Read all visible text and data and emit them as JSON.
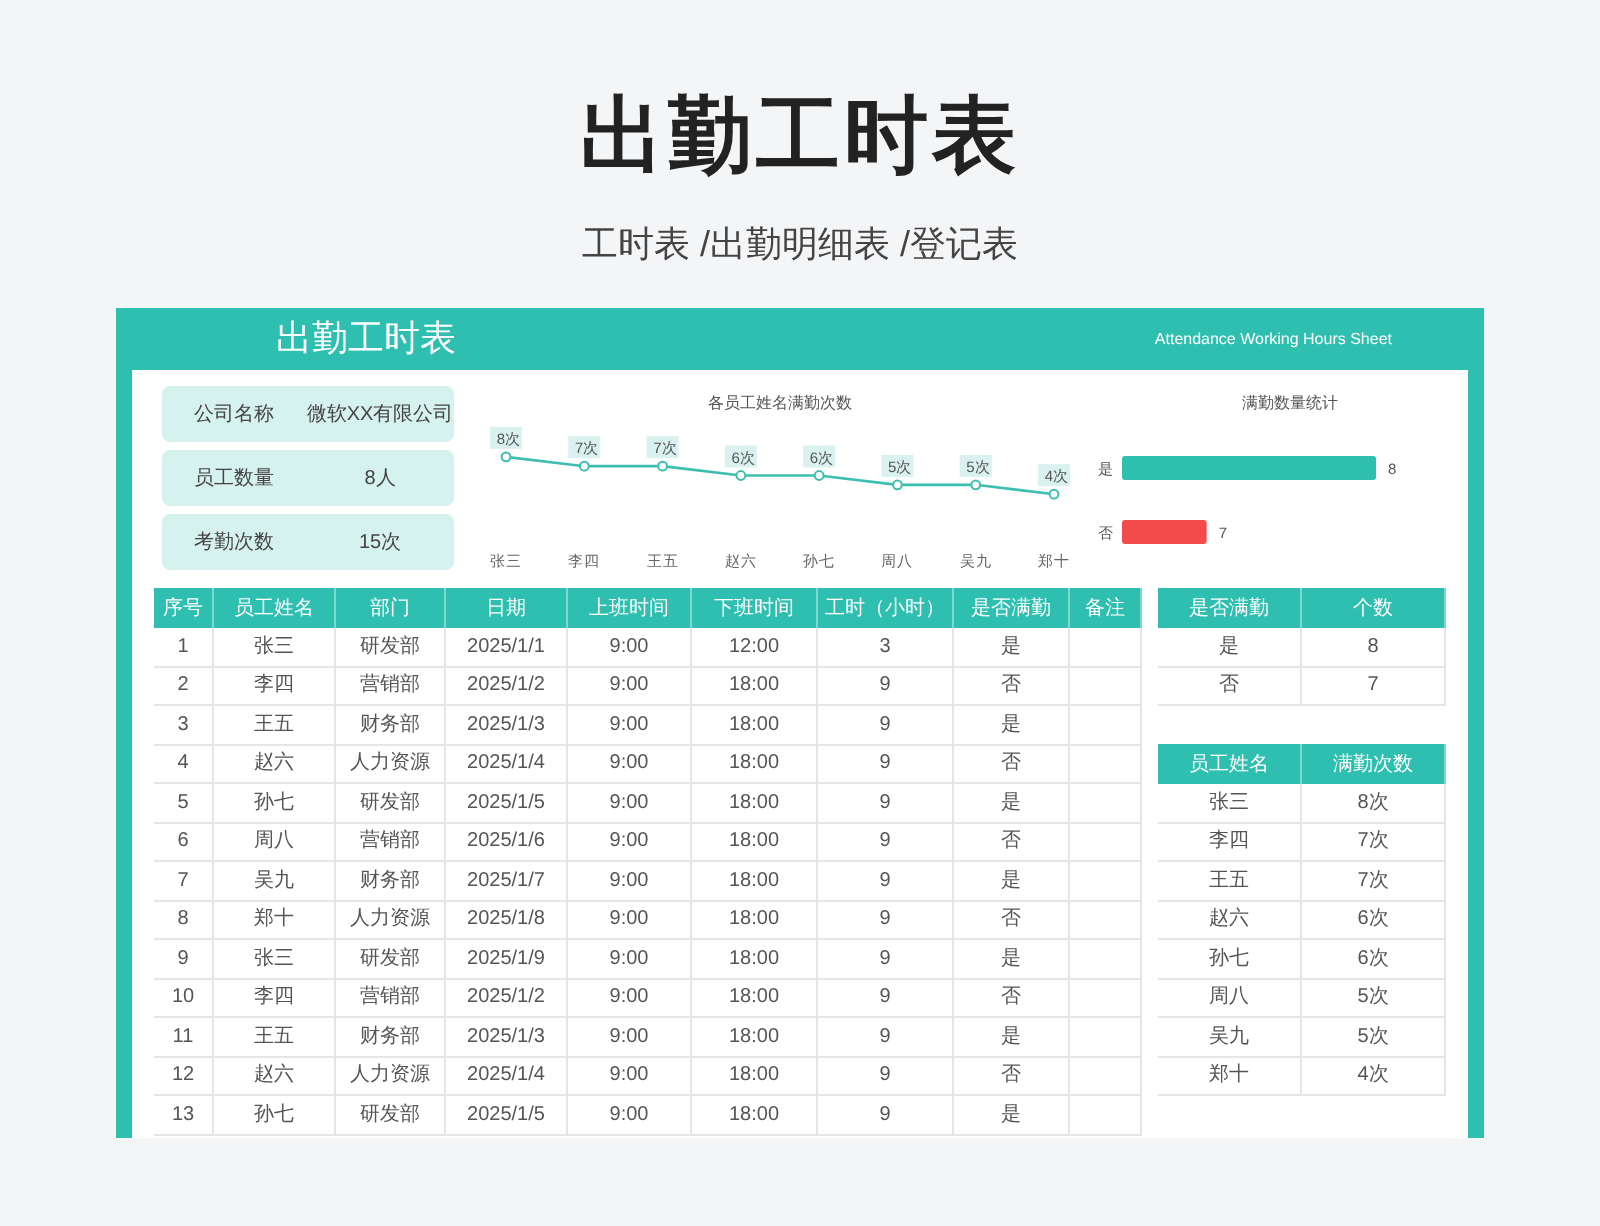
{
  "page": {
    "title": "出勤工时表",
    "subtitle": "工时表 /出勤明细表 /登记表"
  },
  "sheet": {
    "title": "出勤工时表",
    "subtitle": "Attendance Working Hours Sheet",
    "info": [
      {
        "label": "公司名称",
        "value": "微软XX有限公司"
      },
      {
        "label": "员工数量",
        "value": "8人"
      },
      {
        "label": "考勤次数",
        "value": "15次"
      }
    ],
    "line_chart": {
      "chart_data": {
        "type": "line",
        "title": "各员工姓名满勤次数",
        "categories": [
          "张三",
          "李四",
          "王五",
          "赵六",
          "孙七",
          "周八",
          "吴九",
          "郑十"
        ],
        "series": [
          {
            "color": "#3cbfb0",
            "marker": "circle",
            "values": [
              8,
              7,
              7,
              6,
              6,
              5,
              5,
              4
            ]
          }
        ],
        "data_labels": true
      },
      "label_units": [
        "次",
        "次",
        "次",
        "次",
        "次",
        "次",
        "次",
        "次"
      ]
    },
    "bar_chart": {
      "chart_data": {
        "type": "bar",
        "orientation": "horizontal",
        "title": "满勤数量统计",
        "categories": [
          "是",
          "否"
        ],
        "stacked": true,
        "xlim": [
          6.5,
          8
        ],
        "data_labels": true,
        "series": [
          {
            "color": "#2ebfae",
            "values": [
              8,
              null
            ]
          },
          {
            "color": "#f34b4b",
            "values": [
              null,
              7
            ]
          }
        ]
      }
    },
    "table": {
      "columns": [
        "序号",
        "员工姓名",
        "部门",
        "日期",
        "上班时间",
        "下班时间",
        "工时（小时）",
        "是否满勤",
        "备注"
      ],
      "rows": [
        [
          "1",
          "张三",
          "研发部",
          "2025/1/1",
          "9:00",
          "12:00",
          "3",
          "是"
        ],
        [
          "2",
          "李四",
          "营销部",
          "2025/1/2",
          "9:00",
          "18:00",
          "9",
          "否"
        ],
        [
          "3",
          "王五",
          "财务部",
          "2025/1/3",
          "9:00",
          "18:00",
          "9",
          "是"
        ],
        [
          "4",
          "赵六",
          "人力资源",
          "2025/1/4",
          "9:00",
          "18:00",
          "9",
          "否"
        ],
        [
          "5",
          "孙七",
          "研发部",
          "2025/1/5",
          "9:00",
          "18:00",
          "9",
          "是"
        ],
        [
          "6",
          "周八",
          "营销部",
          "2025/1/6",
          "9:00",
          "18:00",
          "9",
          "否"
        ],
        [
          "7",
          "吴九",
          "财务部",
          "2025/1/7",
          "9:00",
          "18:00",
          "9",
          "是"
        ],
        [
          "8",
          "郑十",
          "人力资源",
          "2025/1/8",
          "9:00",
          "18:00",
          "9",
          "否"
        ],
        [
          "9",
          "张三",
          "研发部",
          "2025/1/9",
          "9:00",
          "18:00",
          "9",
          "是"
        ],
        [
          "10",
          "李四",
          "营销部",
          "2025/1/2",
          "9:00",
          "18:00",
          "9",
          "否"
        ],
        [
          "11",
          "王五",
          "财务部",
          "2025/1/3",
          "9:00",
          "18:00",
          "9",
          "是"
        ],
        [
          "12",
          "赵六",
          "人力资源",
          "2025/1/4",
          "9:00",
          "18:00",
          "9",
          "否"
        ],
        [
          "13",
          "孙七",
          "研发部",
          "2025/1/5",
          "9:00",
          "18:00",
          "9",
          "是"
        ]
      ]
    },
    "summary_table": {
      "columns": [
        "是否满勤",
        "个数"
      ],
      "rows": [
        [
          "是",
          "8"
        ],
        [
          "否",
          "7"
        ]
      ]
    },
    "count_table": {
      "columns": [
        "员工姓名",
        "满勤次数"
      ],
      "rows": [
        [
          "张三",
          "8次"
        ],
        [
          "李四",
          "7次"
        ],
        [
          "王五",
          "7次"
        ],
        [
          "赵六",
          "6次"
        ],
        [
          "孙七",
          "6次"
        ],
        [
          "周八",
          "5次"
        ],
        [
          "吴九",
          "5次"
        ],
        [
          "郑十",
          "4次"
        ]
      ]
    }
  }
}
